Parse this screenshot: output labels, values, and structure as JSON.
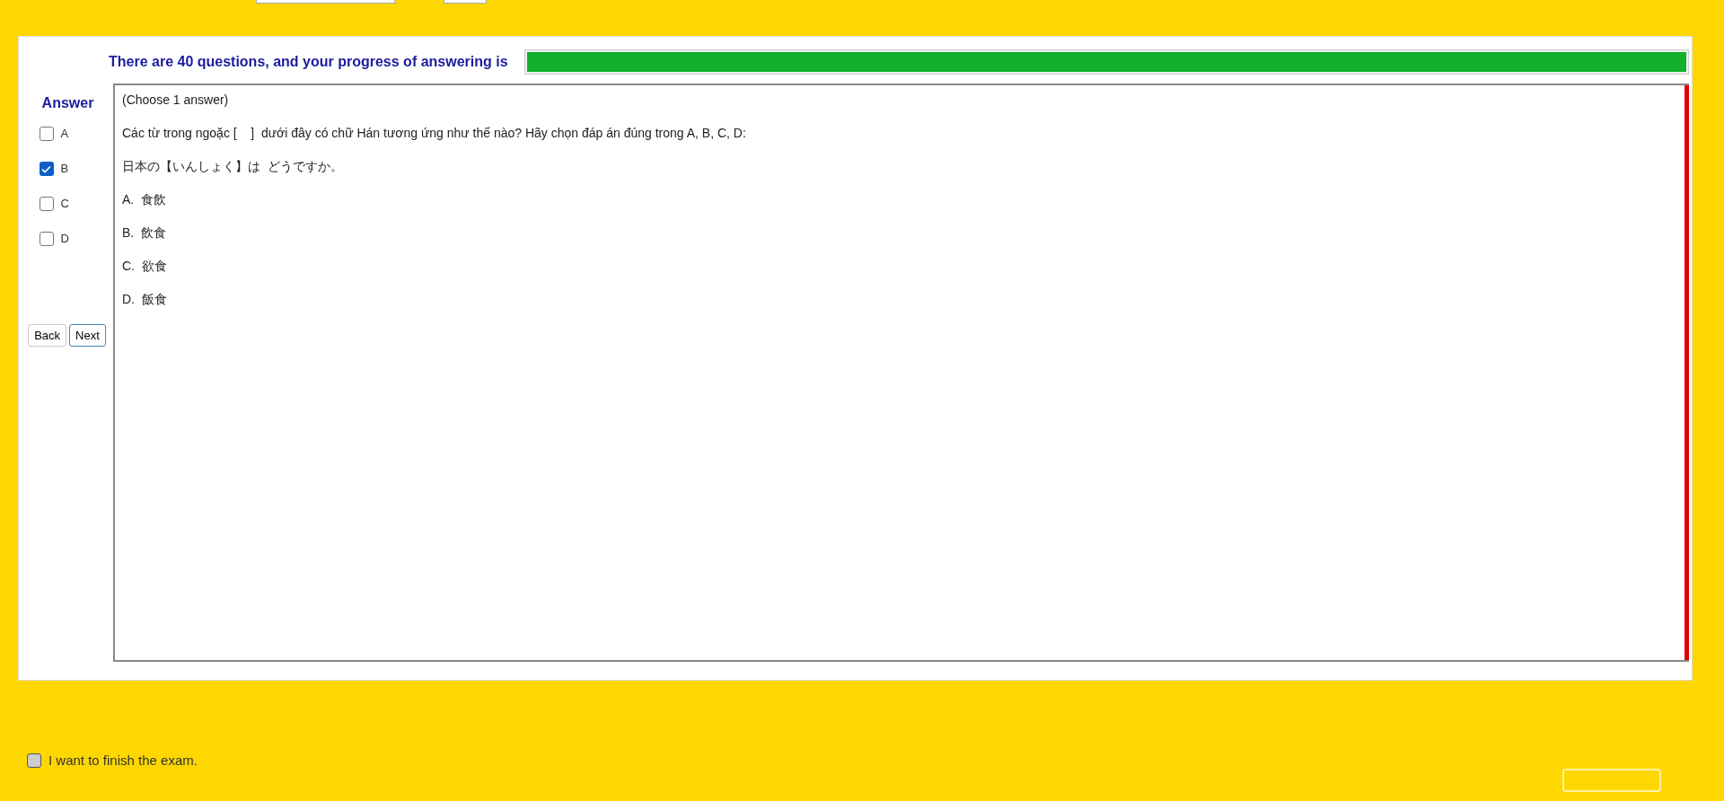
{
  "progress": {
    "label": "There are 40 questions, and your progress of answering is",
    "level": 1
  },
  "answer_panel": {
    "title": "Answer",
    "options": [
      {
        "label": "A",
        "checked": false
      },
      {
        "label": "B",
        "checked": true
      },
      {
        "label": "C",
        "checked": false
      },
      {
        "label": "D",
        "checked": false
      }
    ],
    "buttons": [
      "Back",
      "Next"
    ]
  },
  "question": {
    "instruction": "(Choose 1 answer)",
    "lines": [
      "Các từ trong ngoặc [    ]  dưới đây có chữ Hán tương ứng như thế nào? Hãy chọn đáp án đúng trong A, B, C, D:",
      "日本の【いんしょく】は  どうですか。",
      "A.  食飲",
      "B.  飲食",
      "C.  欲食",
      "D.  飯食"
    ]
  },
  "finish": {
    "label": "I want to finish the exam.",
    "checked": false
  }
}
